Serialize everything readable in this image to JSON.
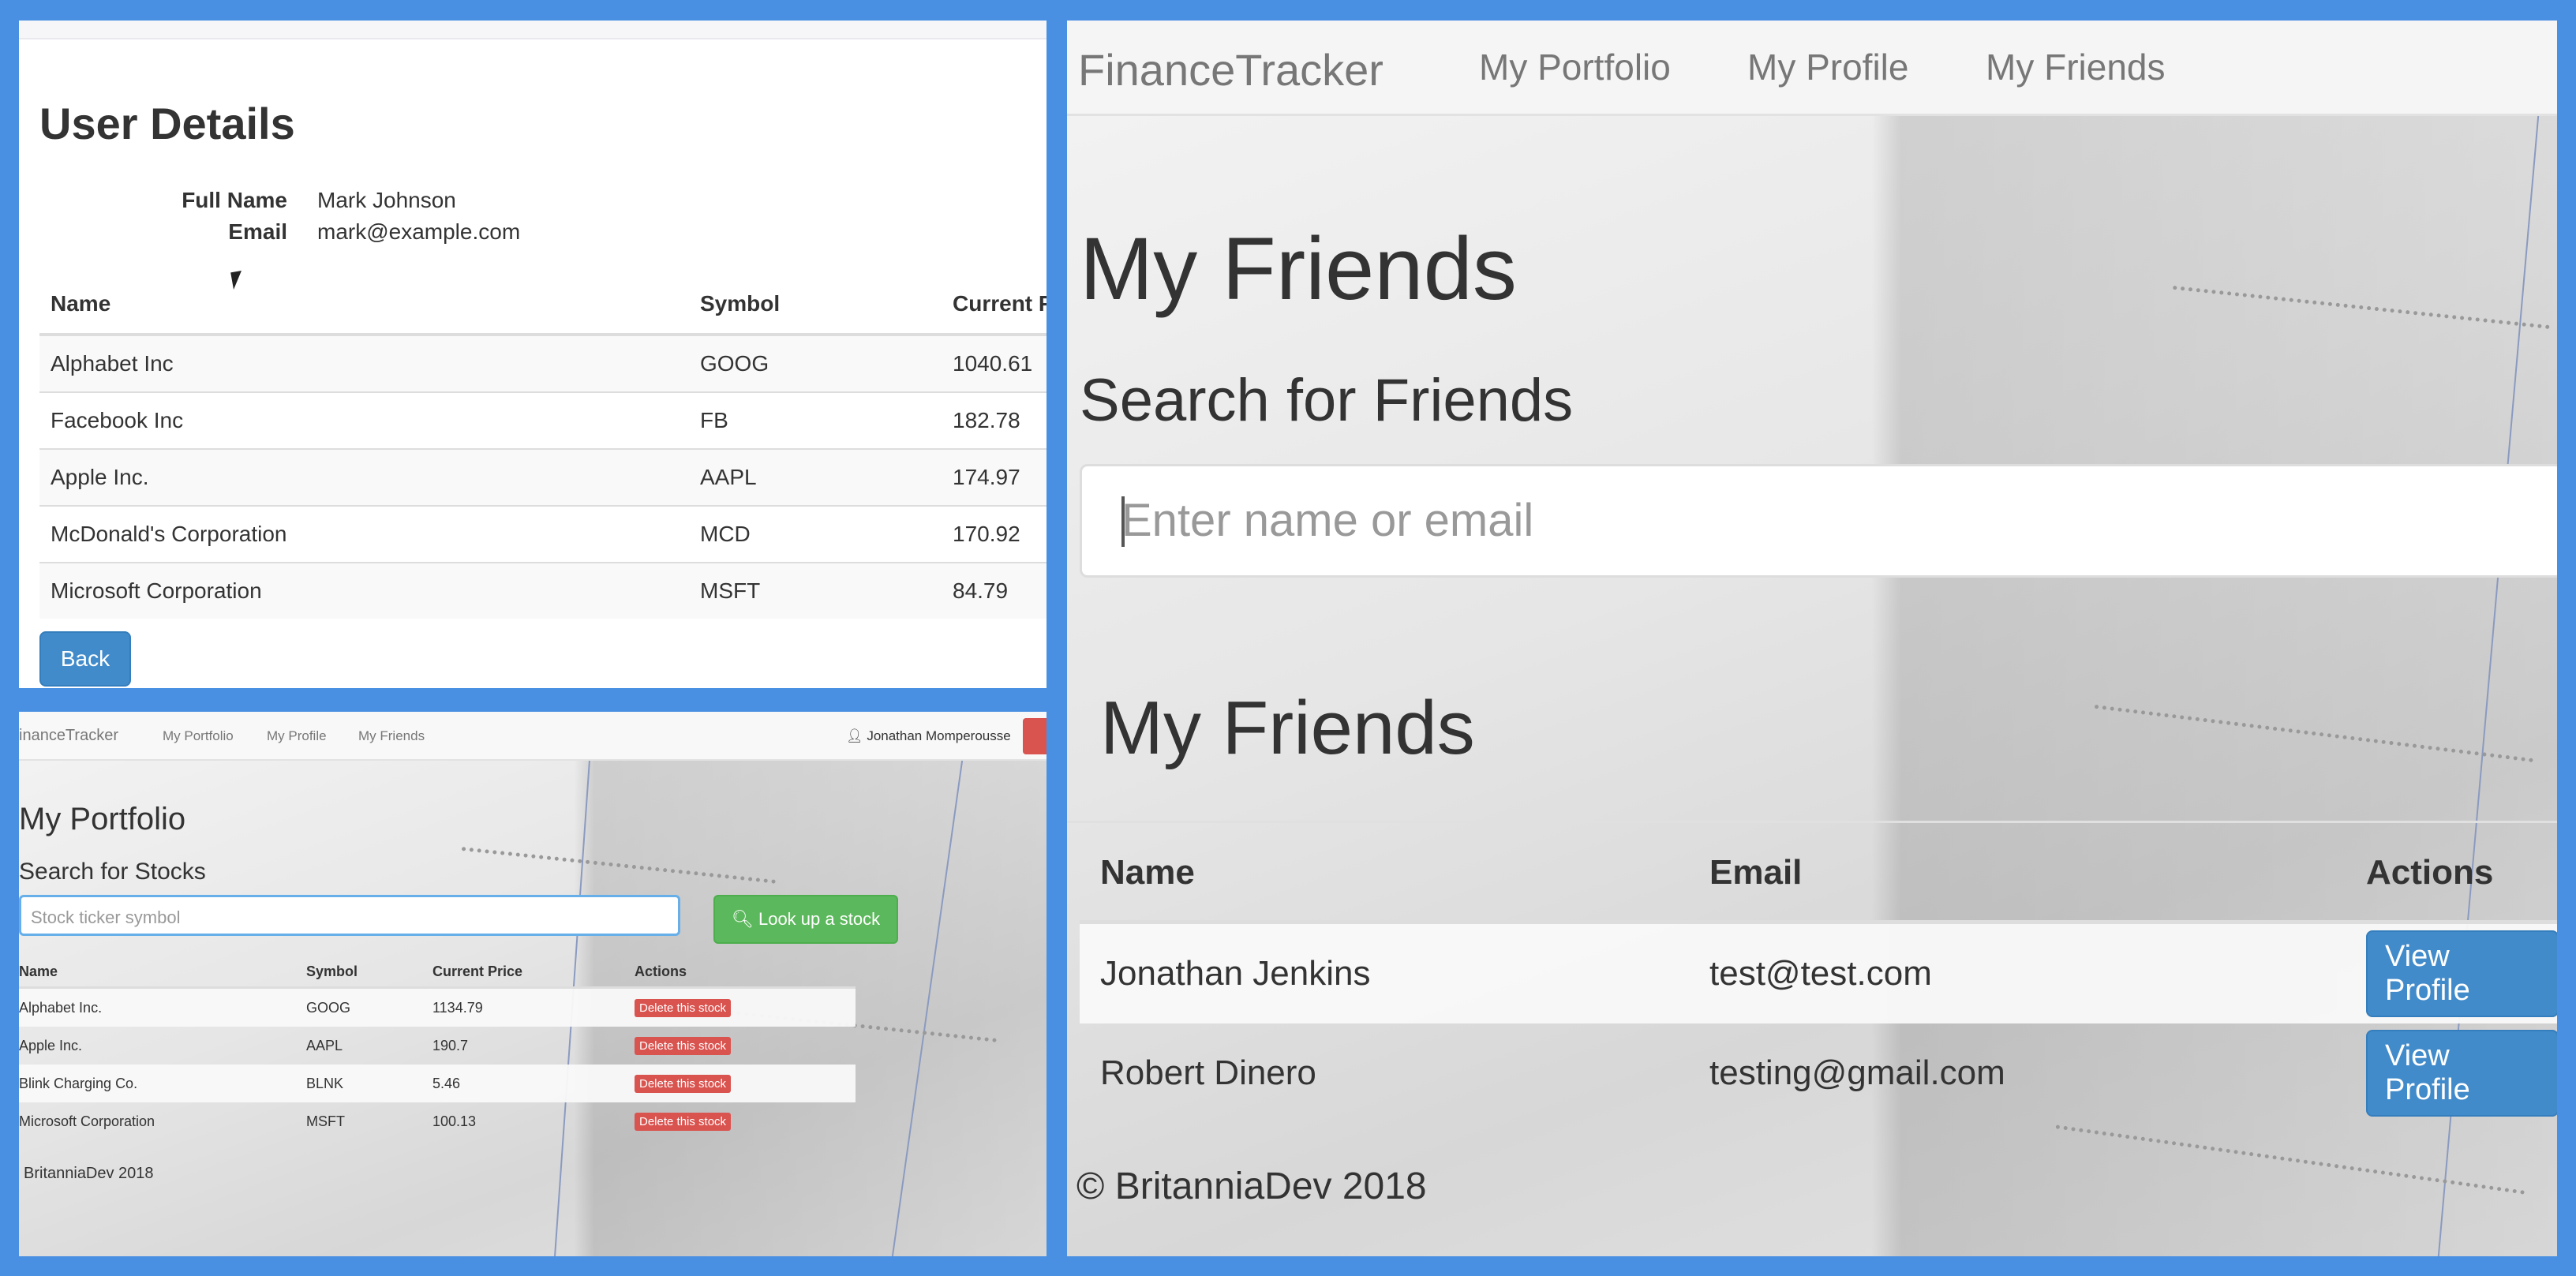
{
  "user_details": {
    "title": "User Details",
    "full_name_label": "Full Name",
    "full_name": "Mark Johnson",
    "email_label": "Email",
    "email": "mark@example.com",
    "columns": [
      "Name",
      "Symbol",
      "Current P"
    ],
    "rows": [
      {
        "name": "Alphabet Inc",
        "symbol": "GOOG",
        "price": "1040.61"
      },
      {
        "name": "Facebook Inc",
        "symbol": "FB",
        "price": "182.78"
      },
      {
        "name": "Apple Inc.",
        "symbol": "AAPL",
        "price": "174.97"
      },
      {
        "name": "McDonald's Corporation",
        "symbol": "MCD",
        "price": "170.92"
      },
      {
        "name": "Microsoft Corporation",
        "symbol": "MSFT",
        "price": "84.79"
      }
    ],
    "back_label": "Back"
  },
  "portfolio": {
    "nav": {
      "brand": "inanceTracker",
      "links": [
        "My Portfolio",
        "My Profile",
        "My Friends"
      ],
      "user": "Jonathan Momperousse"
    },
    "title": "My Portfolio",
    "search_title": "Search for Stocks",
    "search_placeholder": "Stock ticker symbol",
    "lookup_label": "Look up a stock",
    "columns": [
      "Name",
      "Symbol",
      "Current Price",
      "Actions"
    ],
    "rows": [
      {
        "name": "Alphabet Inc.",
        "symbol": "GOOG",
        "price": "1134.79",
        "action": "Delete this stock"
      },
      {
        "name": "Apple Inc.",
        "symbol": "AAPL",
        "price": "190.7",
        "action": "Delete this stock"
      },
      {
        "name": "Blink Charging Co.",
        "symbol": "BLNK",
        "price": "5.46",
        "action": "Delete this stock"
      },
      {
        "name": "Microsoft Corporation",
        "symbol": "MSFT",
        "price": "100.13",
        "action": "Delete this stock"
      }
    ],
    "footer": "BritanniaDev 2018"
  },
  "friends": {
    "nav": {
      "brand": "FinanceTracker",
      "links": [
        "My Portfolio",
        "My Profile",
        "My Friends"
      ]
    },
    "title": "My Friends",
    "search_title": "Search for Friends",
    "search_placeholder": "Enter name or email",
    "list_title": "My Friends",
    "columns": [
      "Name",
      "Email",
      "Actions"
    ],
    "rows": [
      {
        "name": "Jonathan Jenkins",
        "email": "test@test.com",
        "action": "View Profile"
      },
      {
        "name": "Robert Dinero",
        "email": "testing@gmail.com",
        "action": "View Profile"
      }
    ],
    "footer": "© BritanniaDev 2018"
  },
  "colors": {
    "frame": "#4a90e2",
    "primary": "#428bca",
    "success": "#5cb85c",
    "danger": "#d9534f"
  }
}
